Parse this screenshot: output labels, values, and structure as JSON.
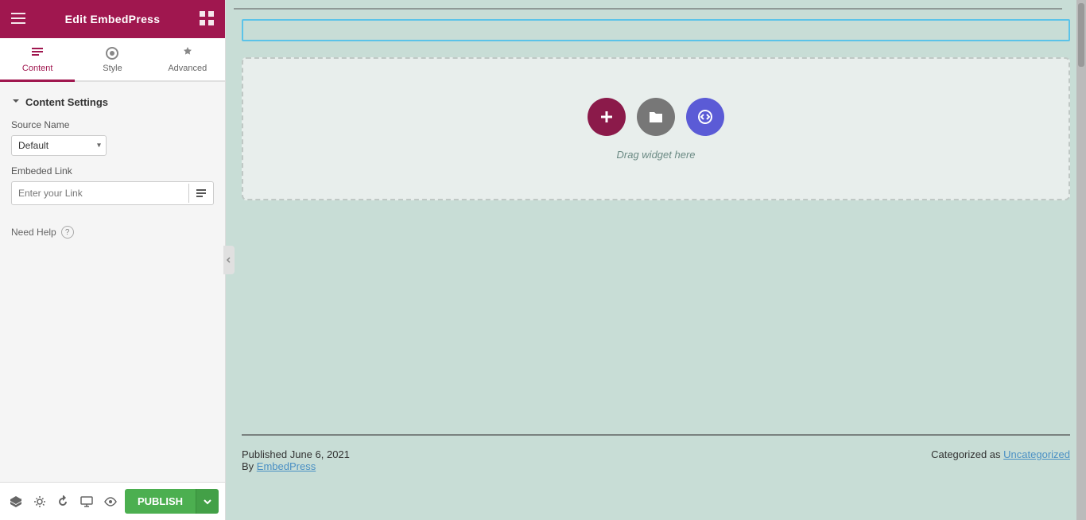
{
  "header": {
    "title": "Edit EmbedPress"
  },
  "tabs": [
    {
      "id": "content",
      "label": "Content",
      "active": true
    },
    {
      "id": "style",
      "label": "Style",
      "active": false
    },
    {
      "id": "advanced",
      "label": "Advanced",
      "active": false
    }
  ],
  "section": {
    "title": "Content Settings"
  },
  "fields": {
    "source_name_label": "Source Name",
    "source_name_default": "Default",
    "embed_link_label": "Embeded Link",
    "embed_link_placeholder": "Enter your Link"
  },
  "drag_area": {
    "text": "Drag widget here"
  },
  "footer": {
    "published_text": "Published June 6, 2021",
    "by_label": "By",
    "by_link": "EmbedPress",
    "categorized_text": "Categorized as",
    "category_link": "Uncategorized"
  },
  "bottom_bar": {
    "publish_label": "PUBLISH"
  },
  "need_help": {
    "label": "Need Help"
  }
}
